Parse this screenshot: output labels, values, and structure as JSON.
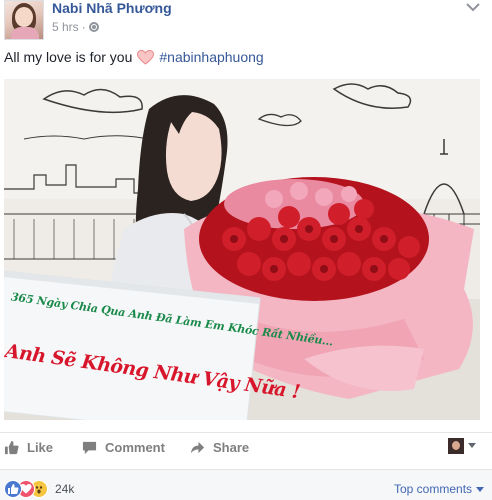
{
  "post": {
    "author_name": "Nabi Nhã Phương",
    "timestamp": "5 hrs",
    "privacy_separator": "·",
    "caption_text": "All my love is for you",
    "hashtag": "#nabinhaphuong",
    "privacy_icon": "globe-icon",
    "options_icon": "chevron-down-icon"
  },
  "photo": {
    "sign_line1": "365 Ngày Chia Qua Anh Đã Làm Em Khóc Rất Nhiều...",
    "sign_line2": "Anh Sẽ Không Như Vậy Nữa !",
    "sign_line1_color": "#1a8a4a",
    "sign_line2_color": "#d8162b"
  },
  "actions": {
    "like_label": "Like",
    "comment_label": "Comment",
    "share_label": "Share"
  },
  "reactions": {
    "count": "24k",
    "sort_label": "Top comments",
    "types": [
      "like-icon",
      "love-icon",
      "wow-icon"
    ]
  },
  "colors": {
    "link_blue": "#365899",
    "action_gray": "#7f7f7f",
    "heart_pink": "#f28b8b"
  }
}
